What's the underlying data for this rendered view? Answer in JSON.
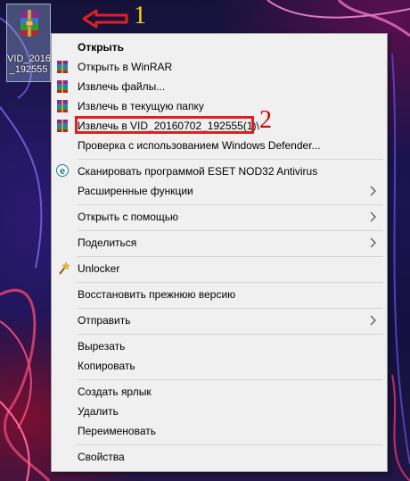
{
  "desktop": {
    "file_label_line1": "VID_2016",
    "file_label_line2": "_192555",
    "annotation_1": "1",
    "annotation_2": "2"
  },
  "menu": {
    "items": [
      {
        "label": "Открыть",
        "bold": true
      },
      {
        "label": "Открыть в WinRAR",
        "icon": "winrar-icon"
      },
      {
        "label": "Извлечь файлы...",
        "icon": "winrar-icon"
      },
      {
        "label": "Извлечь в текущую папку",
        "icon": "winrar-icon"
      },
      {
        "label": "Извлечь в VID_20160702_192555(1)\\",
        "icon": "winrar-icon"
      },
      {
        "label": "Проверка с использованием Windows Defender..."
      },
      {
        "label": "Сканировать программой ESET NOD32 Antivirus",
        "icon": "eset-icon"
      },
      {
        "label": "Расширенные функции",
        "submenu": true
      },
      {
        "label": "Открыть с помощью",
        "submenu": true
      },
      {
        "label": "Поделиться",
        "submenu": true
      },
      {
        "label": "Unlocker",
        "icon": "magic-wand-icon"
      },
      {
        "label": "Восстановить прежнюю версию"
      },
      {
        "label": "Отправить",
        "submenu": true
      },
      {
        "label": "Вырезать"
      },
      {
        "label": "Копировать"
      },
      {
        "label": "Создать ярлык"
      },
      {
        "label": "Удалить"
      },
      {
        "label": "Переименовать"
      },
      {
        "label": "Свойства"
      }
    ]
  }
}
